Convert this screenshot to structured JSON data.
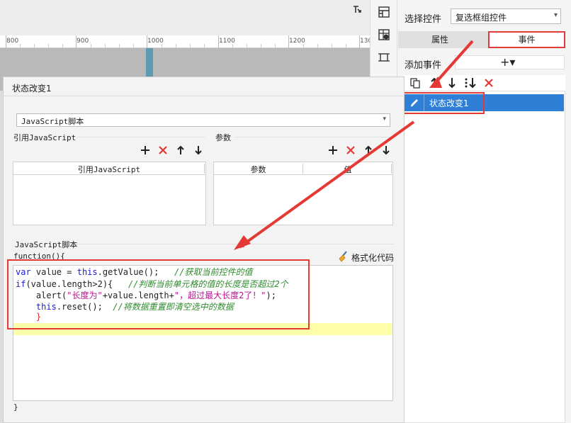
{
  "ruler": {
    "marks": [
      "800",
      "900",
      "1000",
      "1100",
      "1200",
      "130"
    ]
  },
  "right_panel": {
    "select_label": "选择控件",
    "select_value": "复选框组控件",
    "tabs": [
      {
        "label": "属性"
      },
      {
        "label": "事件"
      }
    ],
    "add_event_label": "添加事件",
    "add_event_icon": "+▾",
    "events": [
      {
        "label": "状态改变1"
      }
    ]
  },
  "dialog": {
    "title": "状态改变1",
    "script_type": "JavaScript脚本",
    "ref_js_label": "引用JavaScript",
    "params_label": "参数",
    "ref_table_header": "引用JavaScript",
    "param_table_headers": [
      "参数",
      "值"
    ],
    "script_section_label": "JavaScript脚本",
    "function_open": "function(){",
    "function_close": "}",
    "format_button": "格式化代码",
    "code_lines": [
      {
        "kw": "var",
        "rest1": " value = ",
        "kw2": "this",
        "rest2": ".getValue();   ",
        "comment": "//获取当前控件的值"
      },
      {
        "kw": "if",
        "rest1": "(value.length>2){   ",
        "comment": "//判断当前单元格的值的长度是否超过2个"
      },
      {
        "plain": "    alert(",
        "string": "\"长度为\"",
        "plain2": "+value.length+",
        "string2": "\"，超过最大长度2了！\"",
        "plain3": ");"
      },
      {
        "indent": "    ",
        "kw": "this",
        "rest1": ".reset();  ",
        "comment": "//将数据重置即清空选中的数据"
      },
      {
        "indent": "    ",
        "brace": "}"
      }
    ]
  },
  "colors": {
    "accent_red": "#e53935",
    "selection_blue": "#2f7fd6",
    "highlight_yellow": "#ffffaa"
  }
}
